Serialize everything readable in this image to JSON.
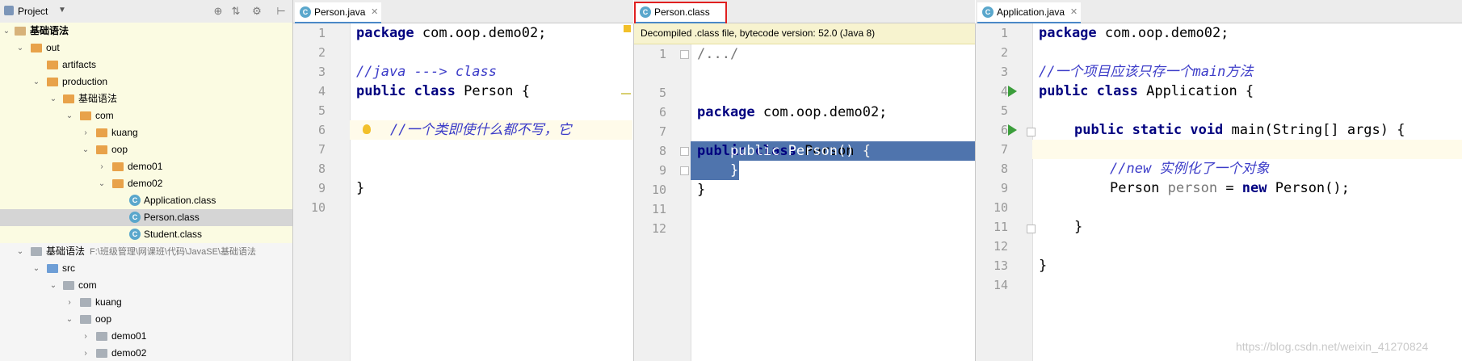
{
  "project": {
    "title": "Project",
    "tree": [
      {
        "label": "基础语法"
      },
      {
        "label": "out"
      },
      {
        "label": "artifacts"
      },
      {
        "label": "production"
      },
      {
        "label": "基础语法"
      },
      {
        "label": "com"
      },
      {
        "label": "kuang"
      },
      {
        "label": "oop"
      },
      {
        "label": "demo01"
      },
      {
        "label": "demo02"
      },
      {
        "label": "Application.class"
      },
      {
        "label": "Person.class"
      },
      {
        "label": "Student.class"
      },
      {
        "label": "基础语法",
        "path": "F:\\班级管理\\网课班\\代码\\JavaSE\\基础语法"
      },
      {
        "label": "src"
      },
      {
        "label": "com"
      },
      {
        "label": "kuang"
      },
      {
        "label": "oop"
      },
      {
        "label": "demo01"
      },
      {
        "label": "demo02"
      }
    ]
  },
  "editor1": {
    "tab": "Person.java",
    "lines": [
      "1",
      "2",
      "3",
      "4",
      "5",
      "6",
      "7",
      "8",
      "9",
      "10"
    ],
    "code": {
      "l1_kw": "package",
      "l1_rest": " com.oop.demo02;",
      "l3": "//java ---> class",
      "l4_kw": "public",
      "l4_kw2": "class",
      "l4_rest": " Person {",
      "l6": "//一个类即使什么都不写，它",
      "l9": "}"
    }
  },
  "editor2": {
    "tab": "Person.class",
    "notice": "Decompiled .class file, bytecode version: 52.0 (Java 8)",
    "lines": [
      "1",
      "5",
      "6",
      "7",
      "8",
      "9",
      "10",
      "11",
      "12"
    ],
    "code": {
      "l1": "/.../",
      "l6_kw": "package",
      "l6_rest": " com.oop.demo02;",
      "l8_kw": "public",
      "l8_kw2": "class",
      "l8_rest": " Person {",
      "l9": "    public Person() {",
      "l10": "    }",
      "l11": "}"
    }
  },
  "editor3": {
    "tab": "Application.java",
    "lines": [
      "1",
      "2",
      "3",
      "4",
      "5",
      "6",
      "7",
      "8",
      "9",
      "10",
      "11",
      "12",
      "13",
      "14"
    ],
    "code": {
      "l1_kw": "package",
      "l1_rest": " com.oop.demo02;",
      "l3": "//一个项目应该只存一个main方法",
      "l4_kw": "public",
      "l4_kw2": "class",
      "l4_rest": " Application {",
      "l6_kw": "public",
      "l6_kw2": "static",
      "l6_kw3": "void",
      "l6_rest": " main(String[] args) {",
      "l8": "//new 实例化了一个对象",
      "l9_a": "Person ",
      "l9_var": "person",
      "l9_b": " = ",
      "l9_kw": "new",
      "l9_c": " Person();",
      "l11": "}",
      "l13": "}"
    }
  },
  "watermark": "https://blog.csdn.net/weixin_41270824"
}
